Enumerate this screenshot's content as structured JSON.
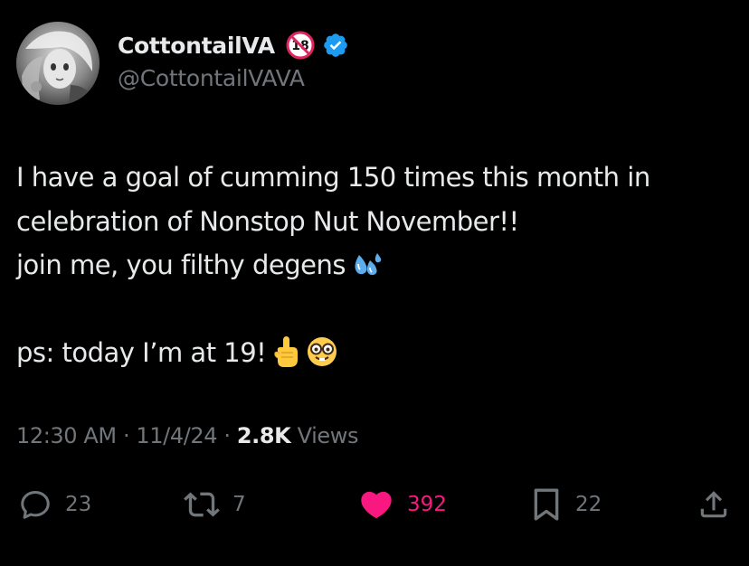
{
  "colors": {
    "background": "#000000",
    "text_primary": "#e7e9ea",
    "text_secondary": "#71767b",
    "verified_blue": "#1d9bf0",
    "like_pink": "#f91880"
  },
  "author": {
    "display_name": "CottontailVA",
    "handle": "@CottontailVAVA",
    "badges": [
      "18-plus-icon",
      "verified-badge-icon"
    ],
    "age_badge_text": "18"
  },
  "tweet": {
    "lines": [
      "I have a goal of cumming 150 times this month in",
      "celebration of Nonstop Nut November!!",
      "join me, you filthy degens",
      "",
      "ps: today I’m at 19!"
    ],
    "emojis": [
      "sweat-droplets-emoji",
      "pointing-up-emoji",
      "nerd-face-emoji"
    ]
  },
  "meta": {
    "time": "12:30 AM",
    "separator": "·",
    "date": "11/4/24",
    "views_count": "2.8K",
    "views_label": "Views"
  },
  "actions": {
    "replies": "23",
    "reposts": "7",
    "likes": "392",
    "bookmarks": "22",
    "liked": true
  }
}
